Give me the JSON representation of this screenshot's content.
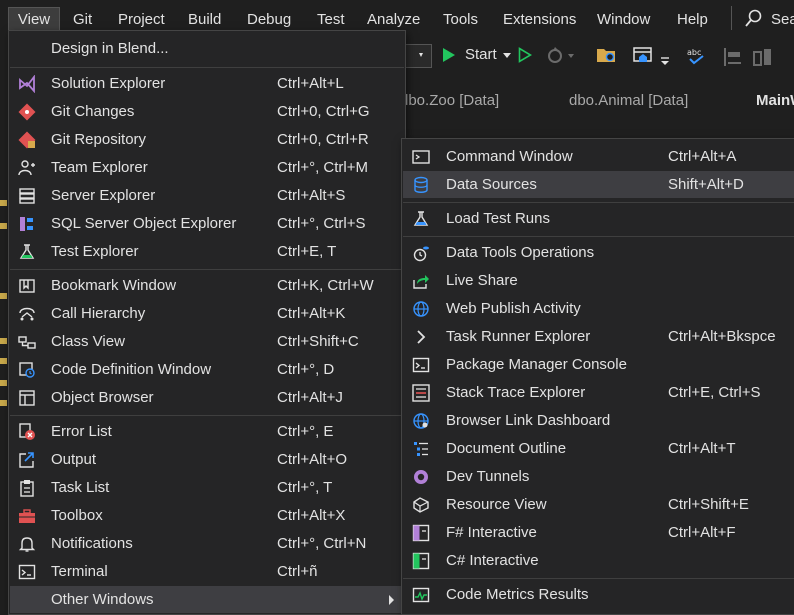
{
  "menubar": {
    "items": [
      "View",
      "Git",
      "Project",
      "Build",
      "Debug",
      "Test",
      "Analyze",
      "Tools",
      "Extensions",
      "Window",
      "Help"
    ],
    "search_label": "Sea"
  },
  "toolbar": {
    "start_label": "Start"
  },
  "document_tabs": [
    "dbo.Zoo [Data]",
    "dbo.Animal [Data]",
    "MainW"
  ],
  "view_menu": {
    "items": [
      {
        "label": "Design in Blend...",
        "shortcut": "",
        "icon": "none"
      },
      {
        "label": "Solution Explorer",
        "shortcut": "Ctrl+Alt+L",
        "icon": "solution-explorer-icon"
      },
      {
        "label": "Git Changes",
        "shortcut": "Ctrl+0, Ctrl+G",
        "icon": "git-changes-icon"
      },
      {
        "label": "Git Repository",
        "shortcut": "Ctrl+0, Ctrl+R",
        "icon": "git-repository-icon"
      },
      {
        "label": "Team Explorer",
        "shortcut": "Ctrl+°, Ctrl+M",
        "icon": "team-explorer-icon"
      },
      {
        "label": "Server Explorer",
        "shortcut": "Ctrl+Alt+S",
        "icon": "server-explorer-icon"
      },
      {
        "label": "SQL Server Object Explorer",
        "shortcut": "Ctrl+°, Ctrl+S",
        "icon": "sql-server-icon"
      },
      {
        "label": "Test Explorer",
        "shortcut": "Ctrl+E, T",
        "icon": "test-explorer-icon"
      },
      {
        "label": "Bookmark Window",
        "shortcut": "Ctrl+K, Ctrl+W",
        "icon": "bookmark-icon"
      },
      {
        "label": "Call Hierarchy",
        "shortcut": "Ctrl+Alt+K",
        "icon": "call-hierarchy-icon"
      },
      {
        "label": "Class View",
        "shortcut": "Ctrl+Shift+C",
        "icon": "class-view-icon"
      },
      {
        "label": "Code Definition Window",
        "shortcut": "Ctrl+°, D",
        "icon": "code-definition-icon"
      },
      {
        "label": "Object Browser",
        "shortcut": "Ctrl+Alt+J",
        "icon": "object-browser-icon"
      },
      {
        "label": "Error List",
        "shortcut": "Ctrl+°, E",
        "icon": "error-list-icon"
      },
      {
        "label": "Output",
        "shortcut": "Ctrl+Alt+O",
        "icon": "output-icon"
      },
      {
        "label": "Task List",
        "shortcut": "Ctrl+°, T",
        "icon": "task-list-icon"
      },
      {
        "label": "Toolbox",
        "shortcut": "Ctrl+Alt+X",
        "icon": "toolbox-icon"
      },
      {
        "label": "Notifications",
        "shortcut": "Ctrl+°, Ctrl+N",
        "icon": "bell-icon"
      },
      {
        "label": "Terminal",
        "shortcut": "Ctrl+ñ",
        "icon": "terminal-icon"
      },
      {
        "label": "Other Windows",
        "shortcut": "",
        "icon": "none"
      }
    ]
  },
  "other_windows_menu": {
    "items": [
      {
        "label": "Command Window",
        "shortcut": "Ctrl+Alt+A",
        "icon": "command-window-icon"
      },
      {
        "label": "Data Sources",
        "shortcut": "Shift+Alt+D",
        "icon": "data-sources-icon"
      },
      {
        "label": "Load Test Runs",
        "shortcut": "",
        "icon": "load-test-icon"
      },
      {
        "label": "Data Tools Operations",
        "shortcut": "",
        "icon": "data-tools-icon"
      },
      {
        "label": "Live Share",
        "shortcut": "",
        "icon": "live-share-icon"
      },
      {
        "label": "Web Publish Activity",
        "shortcut": "",
        "icon": "globe-icon"
      },
      {
        "label": "Task Runner Explorer",
        "shortcut": "Ctrl+Alt+Bkspce",
        "icon": "chevron-right-icon"
      },
      {
        "label": "Package Manager Console",
        "shortcut": "",
        "icon": "console-icon"
      },
      {
        "label": "Stack Trace Explorer",
        "shortcut": "Ctrl+E, Ctrl+S",
        "icon": "stack-trace-icon"
      },
      {
        "label": "Browser Link Dashboard",
        "shortcut": "",
        "icon": "browser-link-icon"
      },
      {
        "label": "Document Outline",
        "shortcut": "Ctrl+Alt+T",
        "icon": "document-outline-icon"
      },
      {
        "label": "Dev Tunnels",
        "shortcut": "",
        "icon": "dev-tunnels-icon"
      },
      {
        "label": "Resource View",
        "shortcut": "Ctrl+Shift+E",
        "icon": "resource-view-icon"
      },
      {
        "label": "F# Interactive",
        "shortcut": "Ctrl+Alt+F",
        "icon": "fsharp-icon"
      },
      {
        "label": "C# Interactive",
        "shortcut": "",
        "icon": "csharp-icon"
      },
      {
        "label": "Code Metrics Results",
        "shortcut": "",
        "icon": "code-metrics-icon"
      }
    ]
  },
  "colors": {
    "accent_purple": "#b180d7",
    "accent_blue": "#3794ff",
    "accent_red": "#e05252",
    "accent_green": "#22c55e"
  }
}
